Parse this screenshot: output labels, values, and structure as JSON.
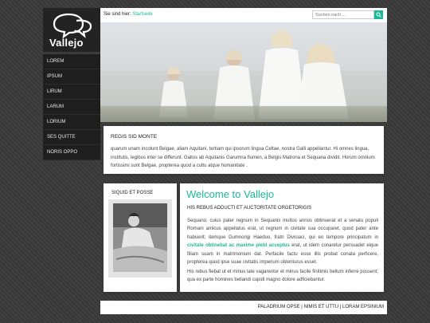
{
  "brand": {
    "name": "Vallejo"
  },
  "sidebar": {
    "items": [
      {
        "label": "LOREM"
      },
      {
        "label": "IPSUM"
      },
      {
        "label": "LIRUM"
      },
      {
        "label": "LARUM"
      },
      {
        "label": "LORIUM"
      },
      {
        "label": "SES QUITTE"
      },
      {
        "label": "NORIS OPPO"
      }
    ]
  },
  "topbar": {
    "breadcrumb_prefix": "Sie sind hier:",
    "breadcrumb_link": "Startseite",
    "search_placeholder": "Suchen nach ..."
  },
  "regis": {
    "title": "REGIS SID MONTE",
    "text": "quarum unam incolunt Belgae, aliam Aquitani, tertiam qui ipsorum lingua Celtae, nostra Galli appellantur. Hi omnes lingua, institutis, legibus inter se differunt. Gallos ab Aquitanis Garumna flumen, a Belgis Matrona et Sequana dividit. Horum omnium fortissimi sunt Belgae, propterea quod a cultu atque humanitate ."
  },
  "siquid": {
    "title": "SIQUID ET POSSE"
  },
  "welcome": {
    "title": "Welcome to Vallejo",
    "subtitle": "HIS REBUS ADDUCTI ET AUCTORITATE ORGETORIGIS",
    "p1_before": "Sequano, cuius pater regnum in Sequanis multos annos obtinuerat et a senatu populi Romani amicus appellatus erat, ut regnum in civitate sua occuparet, quod pater ante habuerit; itemque Dumnorigi Haeduo, fratri Diviciaci, qui eo tempore principatum in ",
    "p1_highlight": "civitate obtinebat ac maxime plebi acceptus",
    "p1_after": " erat, ut idem conaretur persuadet eique filiam suam in matrimonium dat. Perfacile factu esse illis probat conata perficere, propterea quod ipse suae civitatis imperium obtenturus esset.",
    "p2": "His rebus fiebat ut et minus late vagarentur et minus facile finitimis bellum inferre possent; qua ex parte homines bellandi cupidi magno dolore adficiebantur."
  },
  "footer": {
    "links": [
      {
        "label": "PALADRIUM OPSE"
      },
      {
        "label": "NIMIS ET UTTU"
      },
      {
        "label": "LORAM EPSINIUM"
      }
    ],
    "separator": " | "
  },
  "colors": {
    "accent": "#1ab99a",
    "sidebar_bg": "#1e1e1e",
    "page_bg": "#3a3a3a"
  },
  "icons": {
    "logo": "speech-bubbles-icon",
    "search": "search-icon"
  }
}
